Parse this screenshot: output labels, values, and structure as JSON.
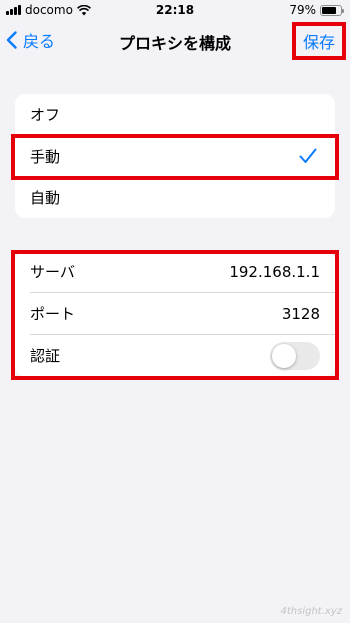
{
  "status_bar": {
    "carrier": "docomo",
    "time": "22:18",
    "battery_percent": "79%",
    "battery_level": 0.79
  },
  "nav": {
    "back_label": "戻る",
    "title": "プロキシを構成",
    "save_label": "保存"
  },
  "mode_options": [
    {
      "label": "オフ",
      "selected": false
    },
    {
      "label": "手動",
      "selected": true
    },
    {
      "label": "自動",
      "selected": false
    }
  ],
  "manual": {
    "server_label": "サーバ",
    "server_value": "192.168.1.1",
    "port_label": "ポート",
    "port_value": "3128",
    "auth_label": "認証",
    "auth_on": false
  },
  "watermark": "4thsight.xyz",
  "colors": {
    "accent": "#0a7aff",
    "highlight": "#e6000a",
    "background": "#f2f2f7"
  }
}
